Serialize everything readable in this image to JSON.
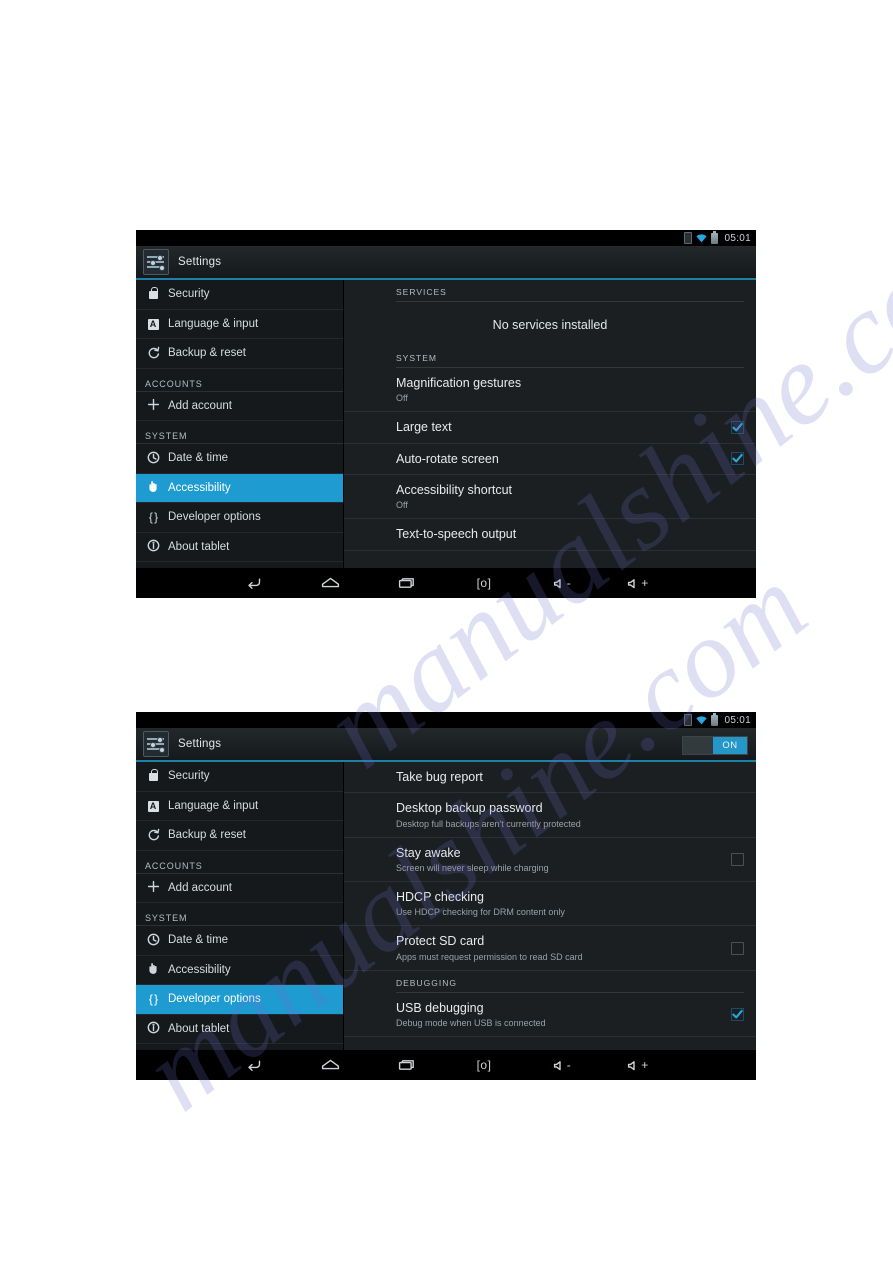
{
  "page": {
    "background": "#ffffff",
    "watermark_lines": [
      "manualshine.com",
      "manualshine.com"
    ]
  },
  "colors": {
    "accent_blue": "#1e9bd1",
    "check_cyan": "#2aa7dd",
    "action_bar_underline": "#1e7fa8",
    "status_bar_bg": "#000000",
    "panel_bg": "#1b1f21",
    "sidebar_bg": "#15191b"
  },
  "screenshots": [
    {
      "id": "accessibility-screen",
      "status_bar": {
        "time": "05:01",
        "icons": [
          "sim-icon",
          "wifi-icon",
          "battery-icon"
        ]
      },
      "action_bar": {
        "app_icon": "settings-sliders-icon",
        "title": "Settings",
        "switch": null
      },
      "sidebar": [
        {
          "type": "item",
          "icon": "lock-icon",
          "label": "Security",
          "selected": false
        },
        {
          "type": "item",
          "icon": "language-a-icon",
          "label": "Language & input",
          "selected": false
        },
        {
          "type": "item",
          "icon": "backup-reset-icon",
          "label": "Backup & reset",
          "selected": false
        },
        {
          "type": "header",
          "label": "ACCOUNTS"
        },
        {
          "type": "item",
          "icon": "plus-icon",
          "label": "Add account",
          "selected": false
        },
        {
          "type": "header",
          "label": "SYSTEM"
        },
        {
          "type": "item",
          "icon": "clock-icon",
          "label": "Date & time",
          "selected": false
        },
        {
          "type": "item",
          "icon": "hand-icon",
          "label": "Accessibility",
          "selected": true
        },
        {
          "type": "item",
          "icon": "braces-icon",
          "label": "Developer options",
          "selected": false
        },
        {
          "type": "item",
          "icon": "info-icon",
          "label": "About tablet",
          "selected": false
        }
      ],
      "content": [
        {
          "type": "header",
          "label": "SERVICES"
        },
        {
          "type": "empty",
          "label": "No services installed"
        },
        {
          "type": "header",
          "label": "SYSTEM"
        },
        {
          "type": "row",
          "title": "Magnification gestures",
          "subtitle": "Off",
          "check": "none"
        },
        {
          "type": "row",
          "title": "Large text",
          "subtitle": "",
          "check": "on"
        },
        {
          "type": "row",
          "title": "Auto-rotate screen",
          "subtitle": "",
          "check": "on"
        },
        {
          "type": "row",
          "title": "Accessibility shortcut",
          "subtitle": "Off",
          "check": "none"
        },
        {
          "type": "row",
          "title": "Text-to-speech output",
          "subtitle": "",
          "check": "none"
        }
      ],
      "nav_bar": [
        {
          "icon": "back-icon",
          "label": ""
        },
        {
          "icon": "home-icon",
          "label": ""
        },
        {
          "icon": "recents-icon",
          "label": ""
        },
        {
          "icon": "screenshot-icon",
          "label": "[o]"
        },
        {
          "icon": "volume-down-icon",
          "label": "-"
        },
        {
          "icon": "volume-up-icon",
          "label": "+"
        }
      ]
    },
    {
      "id": "developer-options-screen",
      "status_bar": {
        "time": "05:01",
        "icons": [
          "sim-icon",
          "wifi-icon",
          "battery-icon"
        ]
      },
      "action_bar": {
        "app_icon": "settings-sliders-icon",
        "title": "Settings",
        "switch": {
          "label": "ON",
          "state": "on"
        }
      },
      "sidebar": [
        {
          "type": "item",
          "icon": "lock-icon",
          "label": "Security",
          "selected": false
        },
        {
          "type": "item",
          "icon": "language-a-icon",
          "label": "Language & input",
          "selected": false
        },
        {
          "type": "item",
          "icon": "backup-reset-icon",
          "label": "Backup & reset",
          "selected": false
        },
        {
          "type": "header",
          "label": "ACCOUNTS"
        },
        {
          "type": "item",
          "icon": "plus-icon",
          "label": "Add account",
          "selected": false
        },
        {
          "type": "header",
          "label": "SYSTEM"
        },
        {
          "type": "item",
          "icon": "clock-icon",
          "label": "Date & time",
          "selected": false
        },
        {
          "type": "item",
          "icon": "hand-icon",
          "label": "Accessibility",
          "selected": false
        },
        {
          "type": "item",
          "icon": "braces-icon",
          "label": "Developer options",
          "selected": true
        },
        {
          "type": "item",
          "icon": "info-icon",
          "label": "About tablet",
          "selected": false
        }
      ],
      "content": [
        {
          "type": "row",
          "title": "Take bug report",
          "subtitle": "",
          "check": "none"
        },
        {
          "type": "row",
          "title": "Desktop backup password",
          "subtitle": "Desktop full backups aren't currently protected",
          "check": "none"
        },
        {
          "type": "row",
          "title": "Stay awake",
          "subtitle": "Screen will never sleep while charging",
          "check": "off"
        },
        {
          "type": "row",
          "title": "HDCP checking",
          "subtitle": "Use HDCP checking for DRM content only",
          "check": "none"
        },
        {
          "type": "row",
          "title": "Protect SD card",
          "subtitle": "Apps must request permission to read SD card",
          "check": "off"
        },
        {
          "type": "header",
          "label": "DEBUGGING"
        },
        {
          "type": "row",
          "title": "USB debugging",
          "subtitle": "Debug mode when USB is connected",
          "check": "on"
        }
      ],
      "nav_bar": [
        {
          "icon": "back-icon",
          "label": ""
        },
        {
          "icon": "home-icon",
          "label": ""
        },
        {
          "icon": "recents-icon",
          "label": ""
        },
        {
          "icon": "screenshot-icon",
          "label": "[o]"
        },
        {
          "icon": "volume-down-icon",
          "label": "-"
        },
        {
          "icon": "volume-up-icon",
          "label": "+"
        }
      ]
    }
  ]
}
